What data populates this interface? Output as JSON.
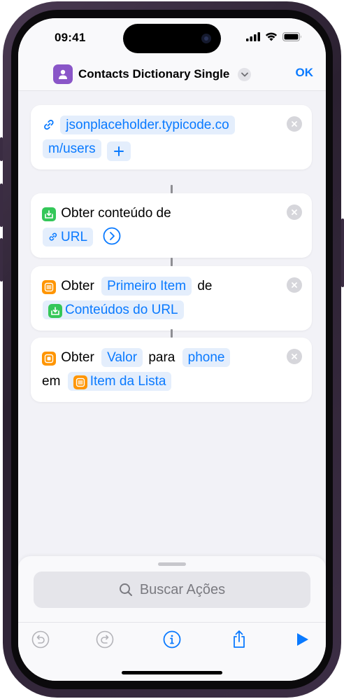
{
  "status_bar": {
    "time": "09:41"
  },
  "nav": {
    "title": "Contacts Dictionary Single",
    "done_label": "OK"
  },
  "actions": [
    {
      "url_line1": "jsonplaceholder.typicode.co",
      "url_line2": "m/users"
    },
    {
      "text": "Obter conteúdo de",
      "param": "URL"
    },
    {
      "verb": "Obter",
      "param": "Primeiro Item",
      "prep": "de",
      "variable": "Conteúdos do URL"
    },
    {
      "verb": "Obter",
      "param1": "Valor",
      "prep1": "para",
      "param2": "phone",
      "prep2": "em",
      "variable": "Item da Lista"
    }
  ],
  "search": {
    "placeholder": "Buscar Ações"
  },
  "colors": {
    "accent": "#0a7aff",
    "app_icon": "#8a56c8",
    "green": "#34c759",
    "orange": "#ff9500"
  }
}
